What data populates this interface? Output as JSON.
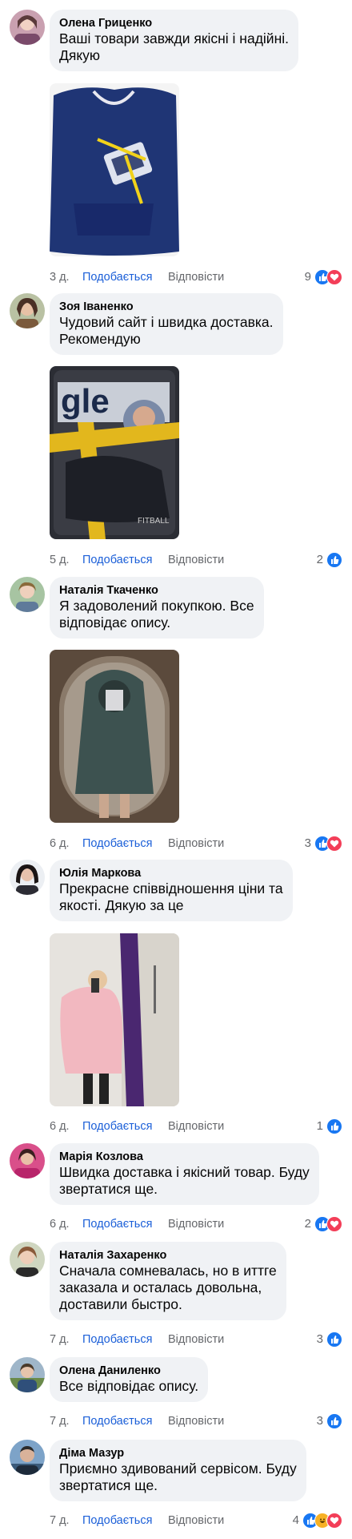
{
  "labels": {
    "like": "Подобається",
    "reply": "Відповісти"
  },
  "colors": {
    "link": "#1b5fd8",
    "bubble": "#f0f2f5",
    "meta": "#65676b",
    "like_reaction": "#1877f2",
    "love_reaction": "#f33e58"
  },
  "comments": [
    {
      "author": "Олена Гриценко",
      "text": "Ваші товари завжди якісні і надійні.\nДякую",
      "time": "3 д.",
      "reaction_count": "9",
      "reactions": [
        "like",
        "love"
      ],
      "has_photo": true
    },
    {
      "author": "Зоя Іваненко",
      "text": "Чудовий сайт і швидка доставка.\nРекомендую",
      "time": "5 д.",
      "reaction_count": "2",
      "reactions": [
        "like"
      ],
      "has_photo": true
    },
    {
      "author": "Наталія Ткаченко",
      "text": "Я задоволений покупкою. Все\nвідповідає опису.",
      "time": "6 д.",
      "reaction_count": "3",
      "reactions": [
        "like",
        "love"
      ],
      "has_photo": true
    },
    {
      "author": "Юлія Маркова",
      "text": "Прекрасне співвідношення ціни та\nякості. Дякую за це",
      "time": "6 д.",
      "reaction_count": "1",
      "reactions": [
        "like"
      ],
      "has_photo": true
    },
    {
      "author": "Марія Козлова",
      "text": "Швидка доставка і якісний товар. Буду\nзвертатися ще.",
      "time": "6 д.",
      "reaction_count": "2",
      "reactions": [
        "like",
        "love"
      ],
      "has_photo": false
    },
    {
      "author": "Наталія Захаренко",
      "text": "Сначала сомневалась, но в иттге\nзаказала и осталась довольна,\nдоставили быстро.",
      "time": "7 д.",
      "reaction_count": "3",
      "reactions": [
        "like"
      ],
      "has_photo": false
    },
    {
      "author": "Олена Даниленко",
      "text": "Все відповідає опису.",
      "time": "7 д.",
      "reaction_count": "3",
      "reactions": [
        "like"
      ],
      "has_photo": false
    },
    {
      "author": "Діма Мазур",
      "text": "Приємно здивований сервісом. Буду\nзвертатися ще.",
      "time": "7 д.",
      "reaction_count": "4",
      "reactions": [
        "like",
        "haha",
        "love"
      ],
      "has_photo": false
    }
  ]
}
